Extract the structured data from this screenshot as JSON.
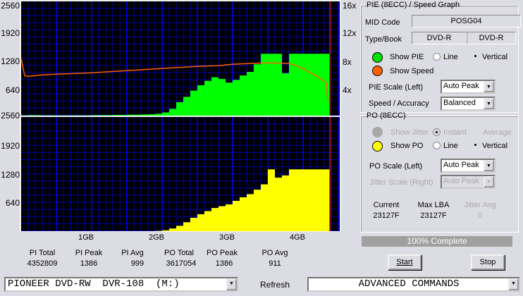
{
  "graph": {
    "left_axis": [
      "2560",
      "1920",
      "1280",
      "640"
    ],
    "po_left_axis": [
      "2560",
      "1920",
      "1280",
      "640"
    ],
    "right_axis": [
      "16x",
      "12x",
      "8x",
      "4x"
    ],
    "x_labels": [
      "1GB",
      "2GB",
      "3GB",
      "4GB"
    ]
  },
  "chart_data": [
    {
      "type": "bar",
      "name": "PIE",
      "ylim": [
        0,
        2560
      ],
      "xlim": [
        0,
        4.52
      ],
      "x_unit": "GB",
      "color": "#00ff00",
      "x": [
        0,
        0.1,
        0.2,
        0.3,
        0.4,
        0.5,
        0.6,
        0.7,
        0.8,
        0.9,
        1.0,
        1.1,
        1.2,
        1.3,
        1.4,
        1.5,
        1.6,
        1.7,
        1.8,
        1.9,
        2.0,
        2.1,
        2.2,
        2.3,
        2.4,
        2.5,
        2.6,
        2.7,
        2.8,
        2.9,
        3.0,
        3.1,
        3.2,
        3.3,
        3.4,
        3.5,
        3.6,
        3.7,
        3.8,
        3.9,
        4.0,
        4.1,
        4.2,
        4.3
      ],
      "values": [
        5,
        10,
        8,
        5,
        5,
        5,
        5,
        5,
        5,
        5,
        10,
        10,
        10,
        15,
        15,
        20,
        20,
        25,
        30,
        40,
        70,
        150,
        300,
        420,
        560,
        680,
        780,
        860,
        820,
        740,
        800,
        900,
        980,
        1150,
        1386,
        1386,
        1386,
        950,
        1386,
        1386,
        1386,
        1386,
        1386,
        1386
      ]
    },
    {
      "type": "line",
      "name": "Speed",
      "ylim": [
        0,
        16
      ],
      "y_unit": "x",
      "color": "#ff6000",
      "x": [
        0,
        0.05,
        0.1,
        0.3,
        0.5,
        1.0,
        1.5,
        2.0,
        2.5,
        2.8,
        3.0,
        3.5,
        3.8,
        3.9,
        4.0,
        4.1,
        4.2,
        4.3,
        4.33,
        4.35
      ],
      "values": [
        8,
        5.6,
        5.5,
        5.7,
        5.8,
        6.0,
        6.3,
        6.6,
        6.9,
        7.0,
        7.2,
        7.4,
        7.3,
        7.0,
        6.6,
        6.0,
        5.5,
        4.8,
        4.6,
        2.0
      ]
    },
    {
      "type": "bar",
      "name": "PO",
      "ylim": [
        0,
        2560
      ],
      "xlim": [
        0,
        4.52
      ],
      "x_unit": "GB",
      "color": "#ffff00",
      "x": [
        0,
        0.1,
        0.2,
        0.3,
        0.4,
        0.5,
        0.6,
        0.7,
        0.8,
        0.9,
        1.0,
        1.1,
        1.2,
        1.3,
        1.4,
        1.5,
        1.6,
        1.7,
        1.8,
        1.9,
        2.0,
        2.1,
        2.2,
        2.3,
        2.4,
        2.5,
        2.6,
        2.7,
        2.8,
        2.9,
        3.0,
        3.1,
        3.2,
        3.3,
        3.4,
        3.5,
        3.6,
        3.7,
        3.8,
        3.9,
        4.0,
        4.1,
        4.2,
        4.3
      ],
      "values": [
        0,
        0,
        0,
        0,
        0,
        0,
        0,
        0,
        0,
        0,
        0,
        0,
        0,
        0,
        0,
        0,
        0,
        0,
        0,
        5,
        20,
        60,
        120,
        200,
        300,
        380,
        450,
        520,
        560,
        600,
        680,
        760,
        830,
        930,
        1050,
        1386,
        1200,
        1250,
        1386,
        1386,
        1386,
        1386,
        1386,
        1386
      ]
    }
  ],
  "end_marker_gb": 4.38,
  "stats": [
    {
      "label": "PI Total",
      "value": "4352809"
    },
    {
      "label": "PI Peak",
      "value": "1386"
    },
    {
      "label": "PI Avg",
      "value": "999"
    },
    {
      "label": "PO Total",
      "value": "3617054"
    },
    {
      "label": "PO Peak",
      "value": "1386"
    },
    {
      "label": "PO Avg",
      "value": "911"
    }
  ],
  "pie_group": {
    "title": "PIE (8ECC) / Speed Graph",
    "mid_label": "MID Code",
    "mid_value": "POSG04",
    "type_label": "Type/Book",
    "type_value": "DVD-R",
    "book_value": "DVD-R",
    "show_pie": "Show PIE",
    "line": "Line",
    "vertical": "Vertical",
    "show_speed": "Show Speed",
    "pie_scale_label": "PIE Scale (Left)",
    "pie_scale_value": "Auto Peak",
    "speed_label": "Speed / Accuracy",
    "speed_value": "Balanced",
    "colors": {
      "pie": "#00e000",
      "speed": "#ff6000"
    }
  },
  "po_group": {
    "title": "PO (8ECC)",
    "show_jitter": "Show Jitter",
    "instant": "Instant",
    "average": "Average",
    "show_po": "Show PO",
    "line": "Line",
    "vertical": "Vertical",
    "po_scale_label": "PO Scale (Left)",
    "po_scale_value": "Auto Peak",
    "jitter_scale_label": "Jitter Scale (Right)",
    "jitter_scale_value": "Auto Peak",
    "current_label": "Current",
    "current_value": "23127F",
    "maxlba_label": "Max LBA",
    "maxlba_value": "23127F",
    "jitter_avg_label": "Jitter Avg",
    "jitter_avg_value": "0",
    "colors": {
      "po": "#ffff00"
    }
  },
  "progress": {
    "text": "100% Complete",
    "percent": 100
  },
  "buttons": {
    "start": "Start",
    "stop": "Stop",
    "refresh": "Refresh"
  },
  "drive": {
    "value": "PIONEER DVD-RW  DVR-108  (M:)"
  },
  "advanced": {
    "value": "ADVANCED COMMANDS"
  }
}
